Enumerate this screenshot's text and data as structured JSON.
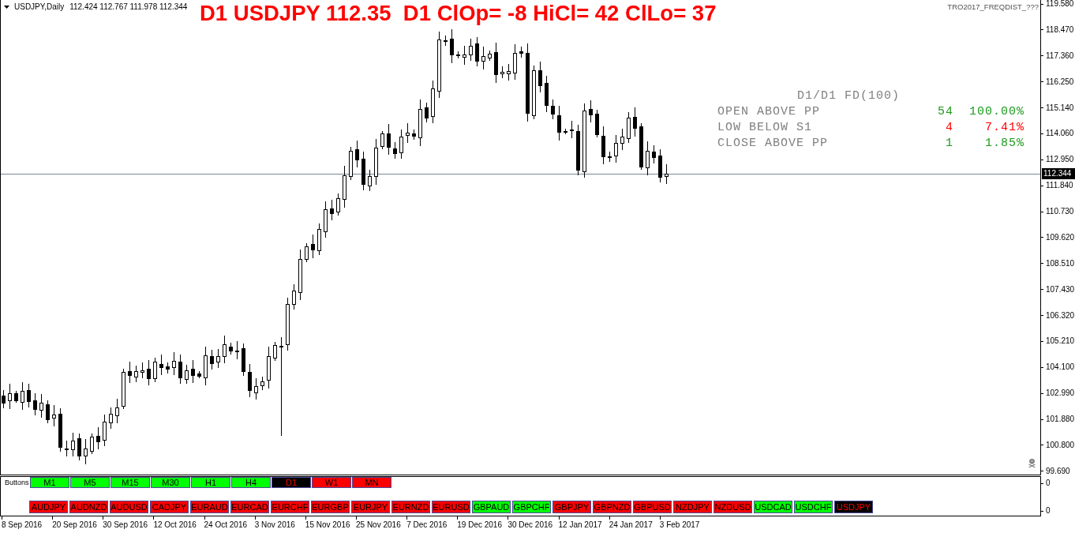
{
  "chart": {
    "caption": "USDJPY,Daily",
    "ohlc": "112.424 112.767 111.978 112.344",
    "headline": "D1 USDJPY 112.35  D1 ClOp= -8 HiCl= 42 ClLo= 37",
    "indicator_name": "TRO2017_FREQDIST_???",
    "current_price": "112.344"
  },
  "stats": {
    "title": "D1/D1 FD(100)",
    "rows": [
      {
        "label": "OPEN ABOVE PP",
        "count": "54",
        "percent": "100.00%",
        "color": "#1e9a1e"
      },
      {
        "label": "LOW BELOW S1",
        "count": "4",
        "percent": "7.41%",
        "color": "#ff0000"
      },
      {
        "label": "CLOSE ABOVE PP",
        "count": "1",
        "percent": "1.85%",
        "color": "#1e9a1e"
      }
    ]
  },
  "price_axis": {
    "labels": [
      "119.580",
      "118.470",
      "117.360",
      "116.250",
      "115.140",
      "114.060",
      "112.950",
      "111.840",
      "110.730",
      "109.620",
      "108.510",
      "107.430",
      "106.320",
      "105.210",
      "104.100",
      "102.990",
      "101.880",
      "100.800",
      "99.690"
    ],
    "subwindow_labels": [
      "0",
      "0"
    ]
  },
  "subwindow": {
    "label": "Buttons",
    "timeframes": [
      {
        "label": "M1",
        "color": "#00ff00",
        "selected": false
      },
      {
        "label": "M5",
        "color": "#00ff00",
        "selected": false
      },
      {
        "label": "M15",
        "color": "#00ff00",
        "selected": false
      },
      {
        "label": "M30",
        "color": "#00ff00",
        "selected": false
      },
      {
        "label": "H1",
        "color": "#00ff00",
        "selected": false
      },
      {
        "label": "H4",
        "color": "#00ff00",
        "selected": false
      },
      {
        "label": "D1",
        "color": "#000000",
        "selected": true
      },
      {
        "label": "W1",
        "color": "#ff0000",
        "selected": false
      },
      {
        "label": "MN",
        "color": "#ff0000",
        "selected": false
      }
    ],
    "symbols": [
      {
        "label": "AUDJPY",
        "color": "#ff0000",
        "selected": false
      },
      {
        "label": "AUDNZD",
        "color": "#ff0000",
        "selected": false
      },
      {
        "label": "AUDUSD",
        "color": "#ff0000",
        "selected": false
      },
      {
        "label": "CADJPY",
        "color": "#ff0000",
        "selected": false
      },
      {
        "label": "EURAUD",
        "color": "#ff0000",
        "selected": false
      },
      {
        "label": "EURCAD",
        "color": "#ff0000",
        "selected": false
      },
      {
        "label": "EURCHF",
        "color": "#ff0000",
        "selected": false
      },
      {
        "label": "EURGBP",
        "color": "#ff0000",
        "selected": false
      },
      {
        "label": "EURJPY",
        "color": "#ff0000",
        "selected": false
      },
      {
        "label": "EURNZD",
        "color": "#ff0000",
        "selected": false
      },
      {
        "label": "EURUSD",
        "color": "#ff0000",
        "selected": false
      },
      {
        "label": "GBPAUD",
        "color": "#00ff00",
        "selected": false
      },
      {
        "label": "GBPCHF",
        "color": "#00ff00",
        "selected": false
      },
      {
        "label": "GBPJPY",
        "color": "#ff0000",
        "selected": false
      },
      {
        "label": "GBPNZD",
        "color": "#ff0000",
        "selected": false
      },
      {
        "label": "GBPUSD",
        "color": "#ff0000",
        "selected": false
      },
      {
        "label": "NZDJPY",
        "color": "#ff0000",
        "selected": false
      },
      {
        "label": "NZDUSD",
        "color": "#ff0000",
        "selected": false
      },
      {
        "label": "USDCAD",
        "color": "#00ff00",
        "selected": false
      },
      {
        "label": "USDCHF",
        "color": "#00ff00",
        "selected": false
      },
      {
        "label": "USDJPY",
        "color": "#000000",
        "selected": true
      }
    ]
  },
  "time_axis": [
    "8 Sep 2016",
    "20 Sep 2016",
    "30 Sep 2016",
    "12 Oct 2016",
    "24 Oct 2016",
    "3 Nov 2016",
    "15 Nov 2016",
    "25 Nov 2016",
    "7 Dec 2016",
    "19 Dec 2016",
    "30 Dec 2016",
    "12 Jan 2017",
    "24 Jan 2017",
    "3 Feb 2017"
  ]
}
